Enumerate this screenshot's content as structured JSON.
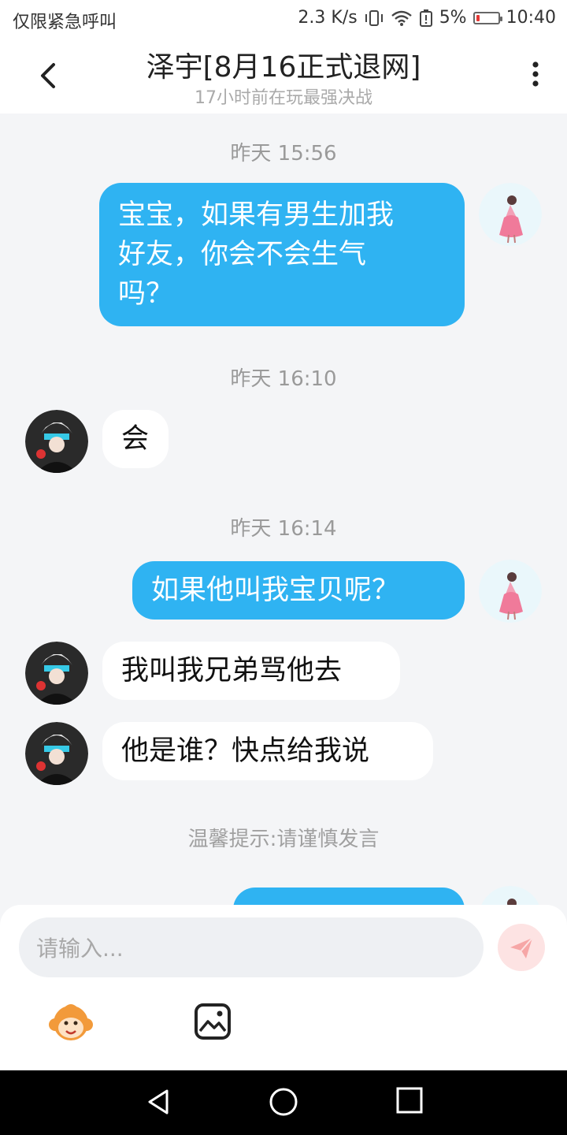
{
  "status_bar": {
    "left_text": "仅限紧急呼叫",
    "net_speed": "2.3 K/s",
    "battery_pct": "5%",
    "time": "10:40"
  },
  "header": {
    "title": "泽宇[8月16正式退网]",
    "subtitle": "17小时前在玩最强决战"
  },
  "messages": [
    {
      "type": "time",
      "text": "昨天 15:56"
    },
    {
      "type": "msg",
      "from": "me",
      "lines": [
        "宝宝，如果有男生加我",
        "好友，你会不会生气",
        "吗？"
      ]
    },
    {
      "type": "time",
      "text": "昨天 16:10"
    },
    {
      "type": "msg",
      "from": "other",
      "text": "会"
    },
    {
      "type": "time",
      "text": "昨天 16:14"
    },
    {
      "type": "msg",
      "from": "me",
      "text": "如果他叫我宝贝呢？"
    },
    {
      "type": "msg",
      "from": "other",
      "text": "我叫我兄弟骂他去"
    },
    {
      "type": "msg",
      "from": "other",
      "text": "他是谁？快点给我说"
    },
    {
      "type": "tip",
      "text": "温馨提示:请谨慎发言"
    }
  ],
  "composer": {
    "placeholder": "请输入..."
  },
  "colors": {
    "my_bubble": "#2fb3f2",
    "other_bubble": "#ffffff",
    "background": "#f4f5f7",
    "send_button": "#f26b6b"
  },
  "icons": {
    "back": "chevron-left-icon",
    "menu": "more-vertical-icon",
    "send": "paper-plane-icon",
    "emoji": "monkey-emoji-icon",
    "image": "image-icon"
  }
}
